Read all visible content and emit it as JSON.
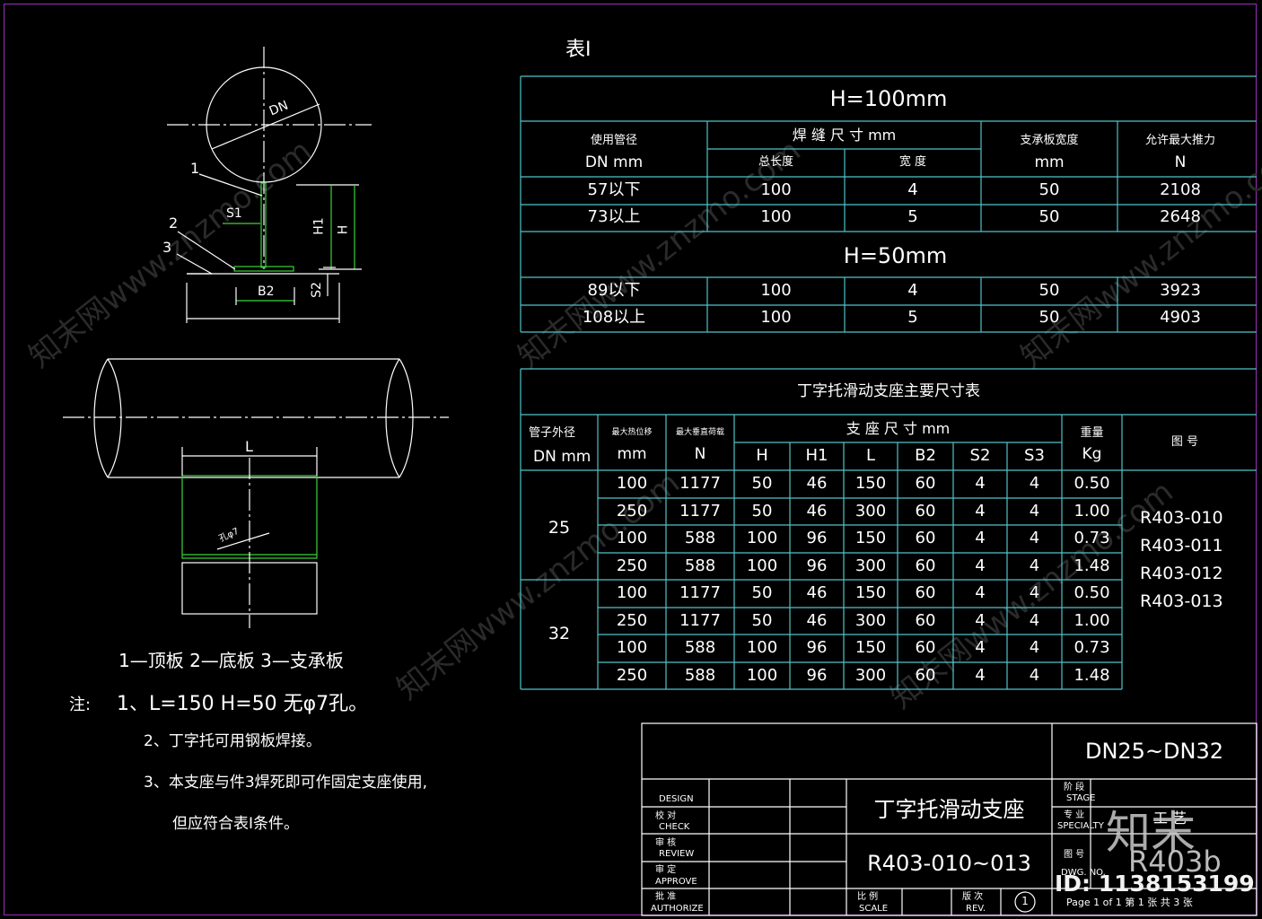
{
  "watermark": {
    "text": "知末网www.znzmo.com",
    "logo": "知末",
    "id": "ID: 1138153199"
  },
  "drawing": {
    "labels": {
      "dn": "DN",
      "l1": "1",
      "l2": "2",
      "l3": "3",
      "s1": "S1",
      "s2": "S2",
      "h1": "H1",
      "h": "H",
      "b2": "B2",
      "l": "L",
      "hole": "孔φ7"
    },
    "legend": "1—顶板   2—底板   3—支承板",
    "notes": {
      "prefix": "注:",
      "n1": "1、L=150  H=50  无φ7孔。",
      "n2": "2、丁字托可用钢板焊接。",
      "n3": "3、本支座与件3焊死即可作固定支座使用,",
      "n3b": "但应符合表Ⅰ条件。"
    }
  },
  "table1": {
    "title": "表Ⅰ",
    "h100": "H=100mm",
    "h50": "H=50mm",
    "col_pipe_a": "使用管径",
    "col_pipe_b": "DN    mm",
    "col_weld": "焊  缝  尺  寸      mm",
    "col_len": "总长度",
    "col_width": "宽  度",
    "col_plate_a": "支承板宽度",
    "col_plate_b": "mm",
    "col_force_a": "允许最大推力",
    "col_force_b": "N",
    "rows": [
      [
        "57以下",
        "100",
        "4",
        "50",
        "2108"
      ],
      [
        "73以上",
        "100",
        "5",
        "50",
        "2648"
      ],
      [
        "89以下",
        "100",
        "4",
        "50",
        "3923"
      ],
      [
        "108以上",
        "100",
        "5",
        "50",
        "4903"
      ]
    ]
  },
  "table2": {
    "title": "丁字托滑动支座主要尺寸表",
    "h_pipe_a": "管子外径",
    "h_pipe_b": "DN  mm",
    "h_disp_a": "最大热位移",
    "h_disp_b": "mm",
    "h_load_a": "最大垂直荷载",
    "h_load_b": "N",
    "h_dims": "支  座  尺  寸      mm",
    "h_sub": [
      "H",
      "H1",
      "L",
      "B2",
      "S2",
      "S3"
    ],
    "h_weight_a": "重量",
    "h_weight_b": "Kg",
    "h_dwg": "图    号",
    "groups": [
      "25",
      "32"
    ],
    "rows": [
      [
        "100",
        "1177",
        "50",
        "46",
        "150",
        "60",
        "4",
        "4",
        "0.50"
      ],
      [
        "250",
        "1177",
        "50",
        "46",
        "300",
        "60",
        "4",
        "4",
        "1.00"
      ],
      [
        "100",
        "588",
        "100",
        "96",
        "150",
        "60",
        "4",
        "4",
        "0.73"
      ],
      [
        "250",
        "588",
        "100",
        "96",
        "300",
        "60",
        "4",
        "4",
        "1.48"
      ],
      [
        "100",
        "1177",
        "50",
        "46",
        "150",
        "60",
        "4",
        "4",
        "0.50"
      ],
      [
        "250",
        "1177",
        "50",
        "46",
        "300",
        "60",
        "4",
        "4",
        "1.00"
      ],
      [
        "100",
        "588",
        "100",
        "96",
        "150",
        "60",
        "4",
        "4",
        "0.73"
      ],
      [
        "250",
        "588",
        "100",
        "96",
        "300",
        "60",
        "4",
        "4",
        "1.48"
      ]
    ],
    "dwg_nos": [
      "R403-010",
      "R403-011",
      "R403-012",
      "R403-013"
    ]
  },
  "title_block": {
    "range": "DN25~DN32",
    "name": "丁字托滑动支座",
    "number": "R403-010~013",
    "design": "DESIGN",
    "check_cn": "校    对",
    "check": "CHECK",
    "review_cn": "审    核",
    "review": "REVIEW",
    "approve_cn": "审    定",
    "approve": "APPROVE",
    "authorize_cn": "批    准",
    "authorize": "AUTHORIZE",
    "scale_cn": "比  例",
    "scale": "SCALE",
    "rev_cn": "版  次",
    "rev": "REV.",
    "rev_no": "1",
    "stage_cn": "阶  段",
    "stage": "STAGE",
    "special_cn": "专  业",
    "special": "SPECIALTY",
    "special_val": "工    艺",
    "dwg_cn": "图  号",
    "dwg": "DWG. NO.",
    "dwg_val": "R403b",
    "page": "Page  1  of  1    第 1 张  共 3 张"
  }
}
